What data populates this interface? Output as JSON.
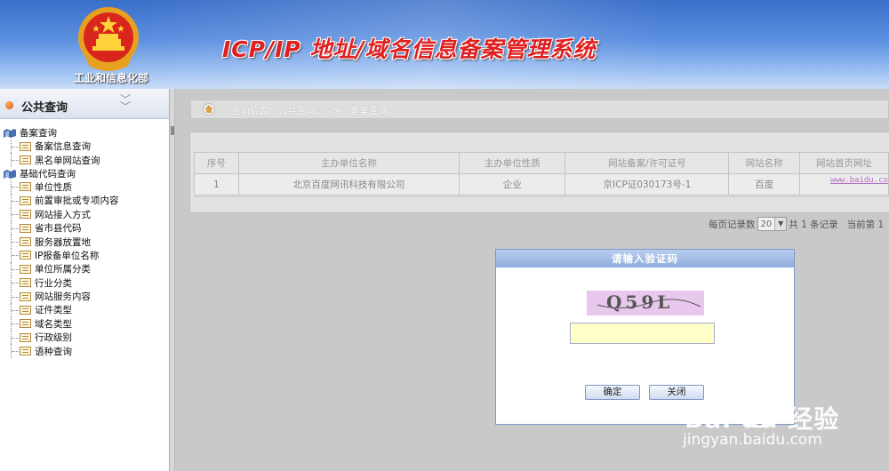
{
  "header": {
    "title": "ICP/IP 地址/域名信息备案管理系统",
    "ministry": "工业和信息化部"
  },
  "sidebar": {
    "title": "公共查询",
    "groups": [
      {
        "label": "备案查询",
        "items": [
          "备案信息查询",
          "黑名单网站查询"
        ]
      },
      {
        "label": "基础代码查询",
        "items": [
          "单位性质",
          "前置审批或专项内容",
          "网站接入方式",
          "省市县代码",
          "服务器放置地",
          "IP报备单位名称",
          "单位所属分类",
          "行业分类",
          "网站服务内容",
          "证件类型",
          "域名类型",
          "行政级别",
          "语种查询"
        ]
      }
    ]
  },
  "breadcrumb": {
    "prefix": "当前位置：",
    "section": "公共查询",
    "arrow": "—>",
    "page": "备案查询"
  },
  "table": {
    "columns": [
      "序号",
      "主办单位名称",
      "主办单位性质",
      "网站备案/许可证号",
      "网站名称",
      "网站首页网址"
    ],
    "rows": [
      [
        "1",
        "北京百度网讯科技有限公司",
        "企业",
        "京ICP证030173号-1",
        "百度",
        "www.baidu.co"
      ]
    ]
  },
  "pager": {
    "per_page_label": "每页记录数",
    "per_page": "20",
    "total_label": "共 1 条记录",
    "current_label": "当前第 1"
  },
  "dialog": {
    "title": "请输入验证码",
    "captcha_code": "Q59L",
    "input_value": "",
    "ok_label": "确定",
    "close_label": "关闭"
  },
  "watermark": {
    "brand": "Bai du 经验",
    "url": "jingyan.baidu.com"
  },
  "colors": {
    "title_red": "#e02020",
    "header_blue": "#3a6fc8",
    "dialog_title": "#8dacdd",
    "captcha_bg": "#e8c8ec",
    "input_bg": "#ffffc8"
  }
}
